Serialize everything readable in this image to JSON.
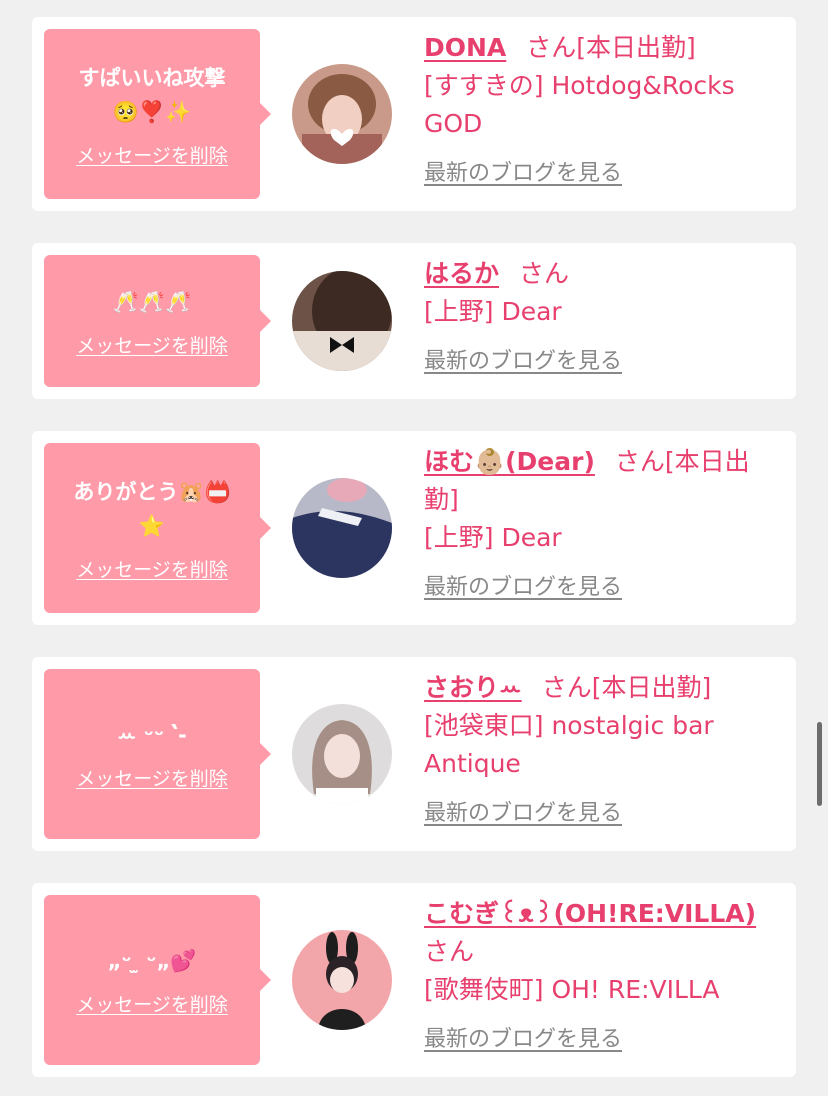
{
  "colors": {
    "page_bg": "#f0f0f0",
    "card_bg": "#ffffff",
    "bubble_bg": "#ff9aa8",
    "accent_pink": "#e8406e",
    "link_gray": "#888888"
  },
  "items": [
    {
      "message": "すぱいいね攻撃\n🥺❣️✨",
      "delete_label": "メッセージを削除",
      "name": "DONA",
      "san": "さん",
      "status": "[本日出勤]",
      "shop": "[すすきの] Hotdog&Rocks GOD",
      "blog_label": "最新のブログを見る",
      "avatar_icon": "photo-avatar-icon"
    },
    {
      "message": "🥂🥂🥂",
      "delete_label": "メッセージを削除",
      "name": "はるか",
      "san": "さん",
      "status": "",
      "shop": "[上野] Dear",
      "blog_label": "最新のブログを見る",
      "avatar_icon": "photo-avatar-icon"
    },
    {
      "message": "ありがとう🐹📛\n⭐️",
      "delete_label": "メッセージを削除",
      "name": "ほむ👶🏼(Dear)",
      "san": "さん",
      "status": "[本日出勤]",
      "shop": "[上野] Dear",
      "blog_label": "最新のブログを見る",
      "avatar_icon": "photo-avatar-icon"
    },
    {
      "message": "ꕀ ᵕᵕ ՝-",
      "delete_label": "メッセージを削除",
      "name": "さおりꕀ",
      "san": "さん",
      "status": "[本日出勤]",
      "shop": "[池袋東口] nostalgic bar Antique",
      "blog_label": "最新のブログを見る",
      "avatar_icon": "photo-avatar-icon"
    },
    {
      "message": "„ᵕ ̫ ᵕ„💕",
      "delete_label": "メッセージを削除",
      "name": "こむぎ꒰ᴥ꒱(OH!RE:VILLA)",
      "san": "さん",
      "status": "",
      "shop": "[歌舞伎町] OH! RE:VILLA",
      "blog_label": "最新のブログを見る",
      "avatar_icon": "photo-avatar-icon"
    }
  ]
}
